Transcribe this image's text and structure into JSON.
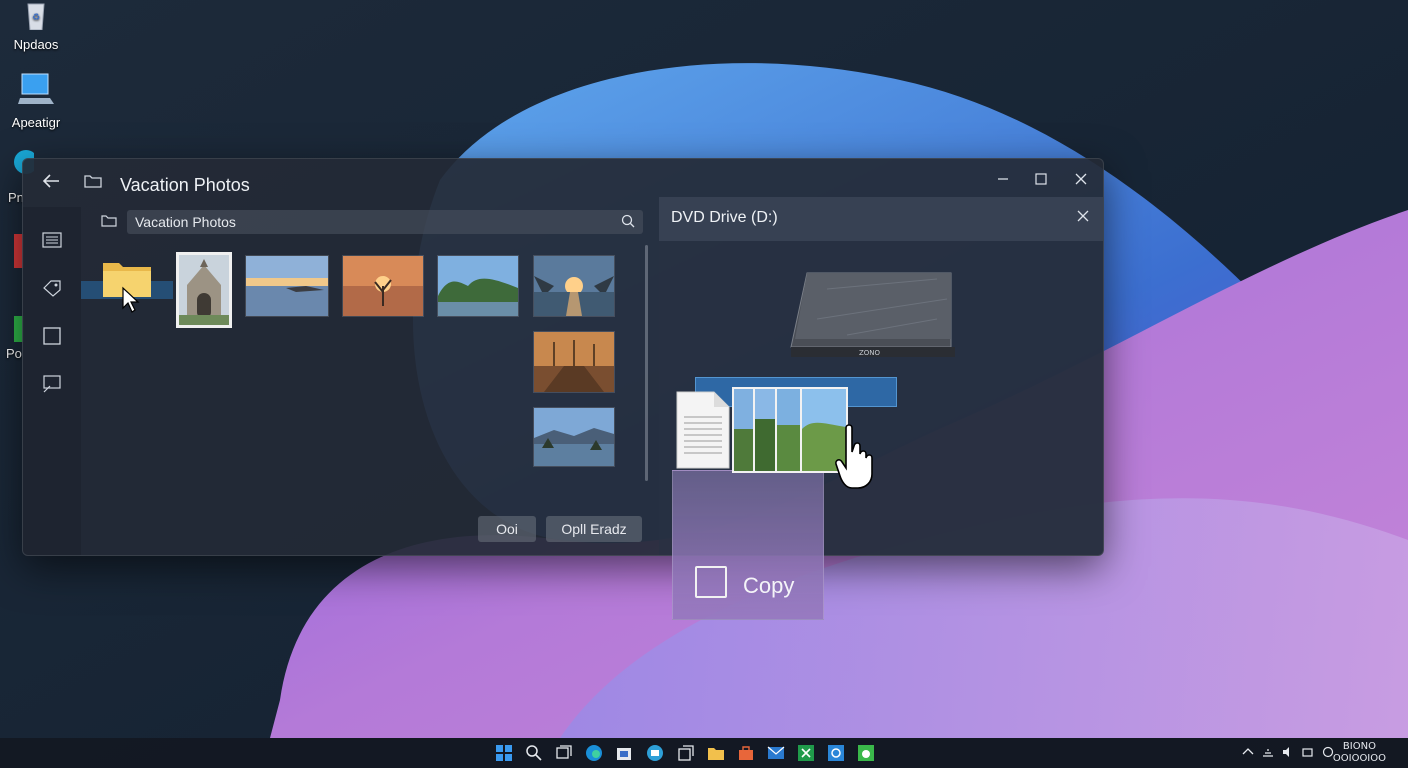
{
  "desktop": {
    "icons": [
      {
        "label": "Npdaos",
        "icon": "recycle-bin-icon"
      },
      {
        "label": "Apeatigr",
        "icon": "monitor-icon"
      },
      {
        "label": "Pn",
        "icon": "edge-icon"
      },
      {
        "label": "Po",
        "icon": "app-icon"
      }
    ]
  },
  "explorer": {
    "title": "Vacation Photos",
    "address": "Vacation Photos",
    "rail_icons": [
      "list-icon",
      "tag-icon",
      "square-icon",
      "screen-icon"
    ],
    "buttons": {
      "open": "Ooi",
      "open_as": "Opll Eradz"
    }
  },
  "dvd": {
    "title": "DVD Drive (D:)",
    "device_label": "ZONO"
  },
  "drag": {
    "tooltip_label": "Copy"
  },
  "taskbar": {
    "apps": [
      "start-icon",
      "search-icon",
      "task-view-icon",
      "edge-icon",
      "store-icon",
      "teams-icon",
      "widgets-icon",
      "explorer-icon",
      "shop-icon",
      "mail-icon",
      "excel-icon",
      "outlook-icon",
      "app-green-icon"
    ],
    "clock_time": "BIONO",
    "clock_date": "OOIOOIOO"
  },
  "colors": {
    "accent": "#2f6fb0",
    "wallpaper_blue": "#4a8fe0",
    "wallpaper_purple": "#a060d8"
  }
}
